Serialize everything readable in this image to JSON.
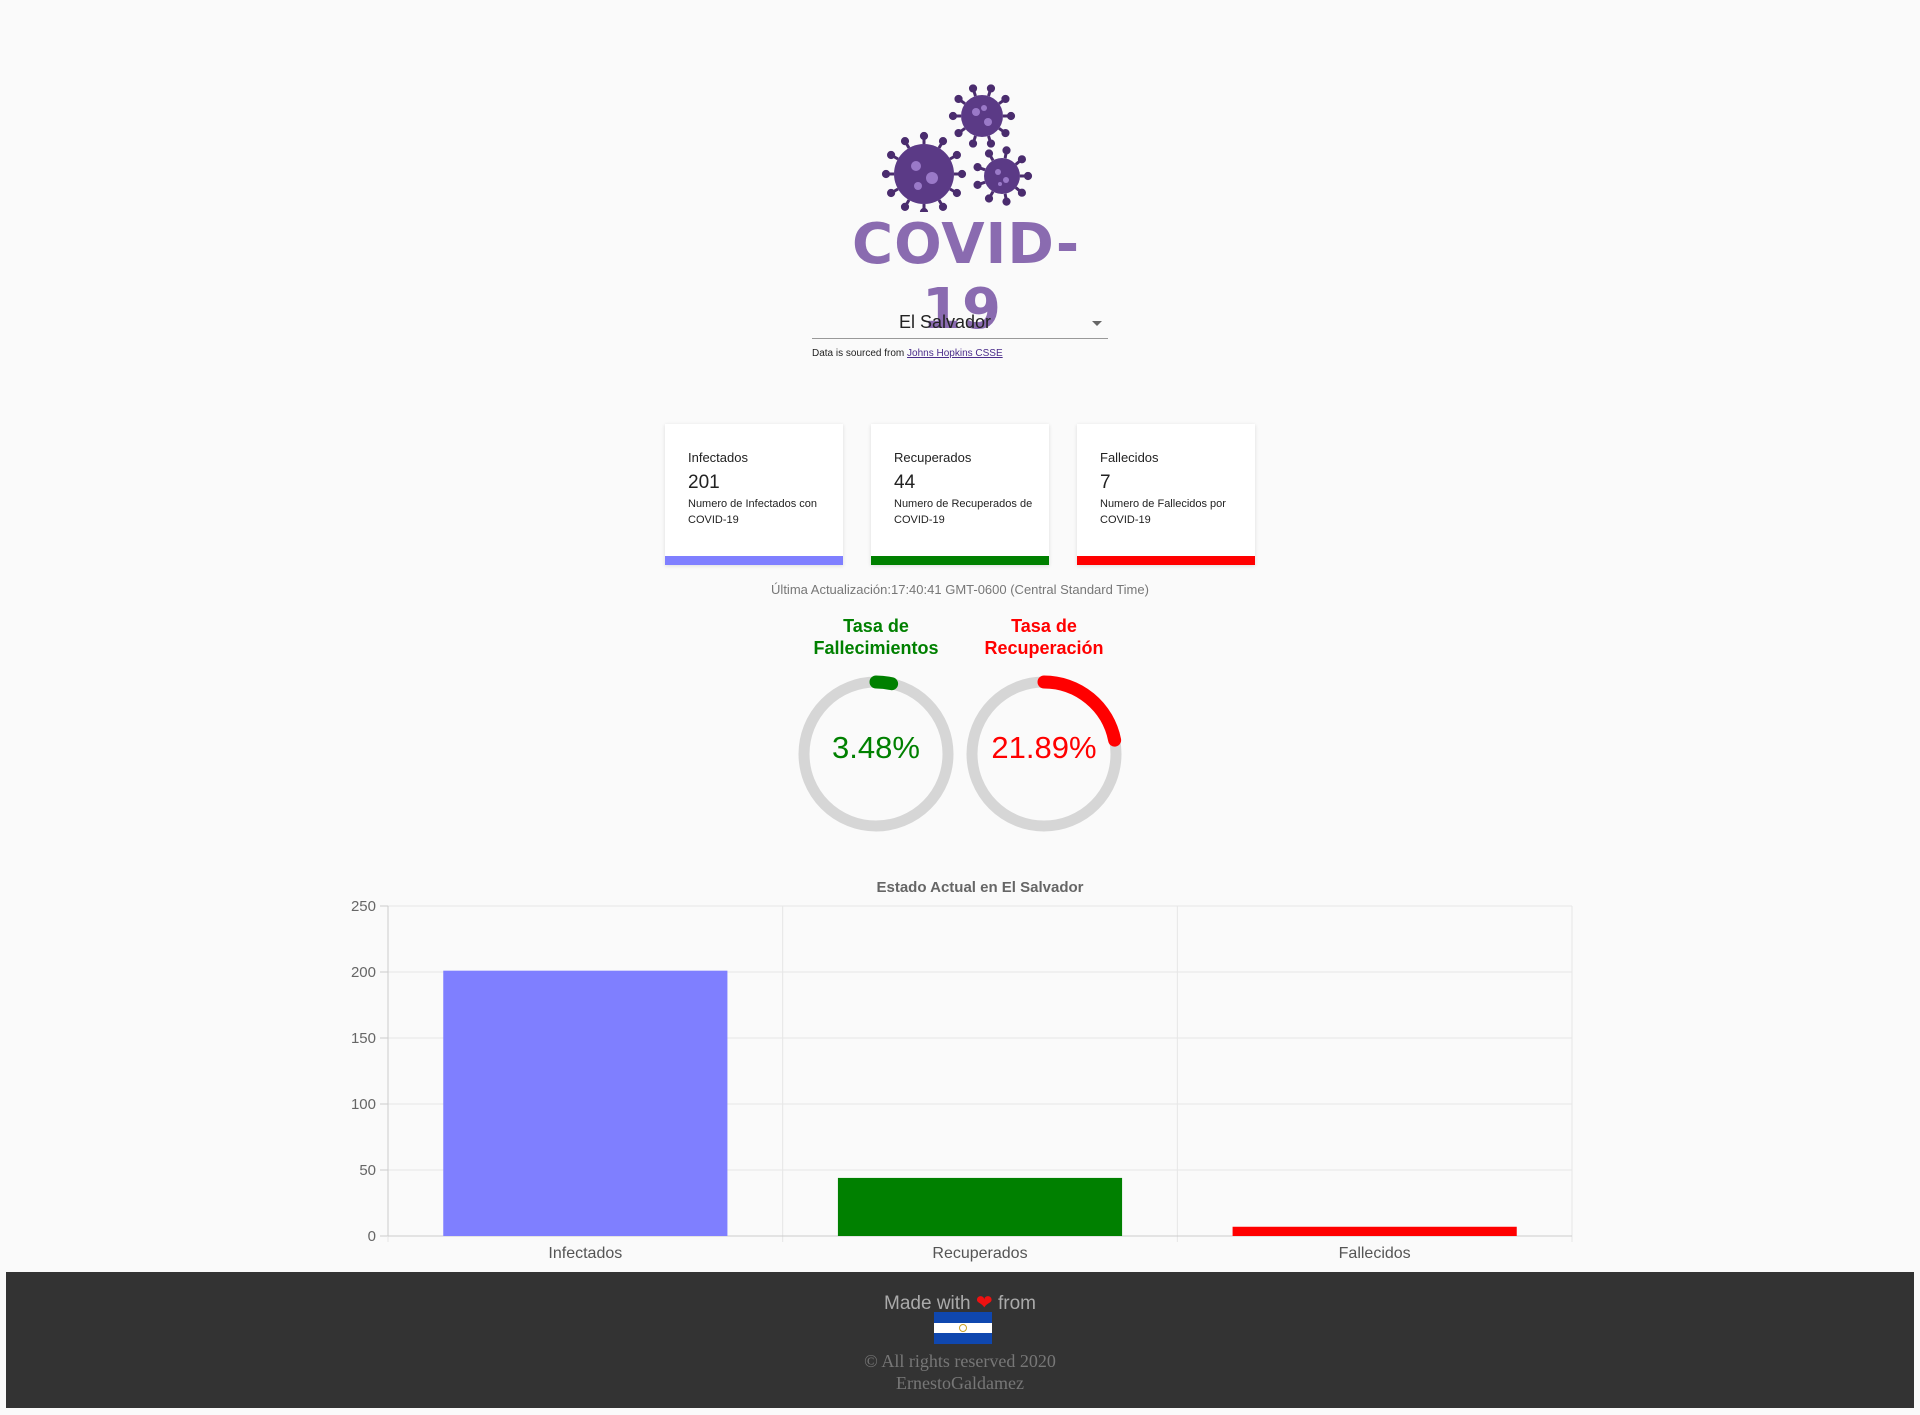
{
  "app": {
    "title": "COVID-19"
  },
  "country_select": {
    "value": "El Salvador"
  },
  "source": {
    "prefix": "Data is sourced from",
    "link_text": "Johns Hopkins CSSE"
  },
  "cards": [
    {
      "title": "Infectados",
      "count": "201",
      "description": "Numero de Infectados con COVID-19",
      "color": "#7f7fff"
    },
    {
      "title": "Recuperados",
      "count": "44",
      "description": "Numero de Recuperados de COVID-19",
      "color": "#008000"
    },
    {
      "title": "Fallecidos",
      "count": "7",
      "description": "Numero de Fallecidos por COVID-19",
      "color": "#ff0000"
    }
  ],
  "last_update": "Última Actualización:17:40:41 GMT-0600 (Central Standard Time)",
  "gauges": [
    {
      "title": "Tasa de Fallecimientos",
      "value_text": "3.48%",
      "percent": 3.48,
      "color": "#008000"
    },
    {
      "title": "Tasa de Recuperación",
      "value_text": "21.89%",
      "percent": 21.89,
      "color": "#ff0000"
    }
  ],
  "chart_data": {
    "type": "bar",
    "title": "Estado Actual en El Salvador",
    "categories": [
      "Infectados",
      "Recuperados",
      "Fallecidos"
    ],
    "values": [
      201,
      44,
      7
    ],
    "colors": [
      "#7f7fff",
      "#008000",
      "#ff0000"
    ],
    "ylim": [
      0,
      250
    ],
    "yticks": [
      0,
      50,
      100,
      150,
      200,
      250
    ],
    "grid": true,
    "legend": false
  },
  "footer": {
    "made_prefix": "Made with",
    "heart": "❤",
    "made_suffix": "from",
    "copyright": "© All rights reserved 2020",
    "author": "ErnestoGaldamez"
  }
}
